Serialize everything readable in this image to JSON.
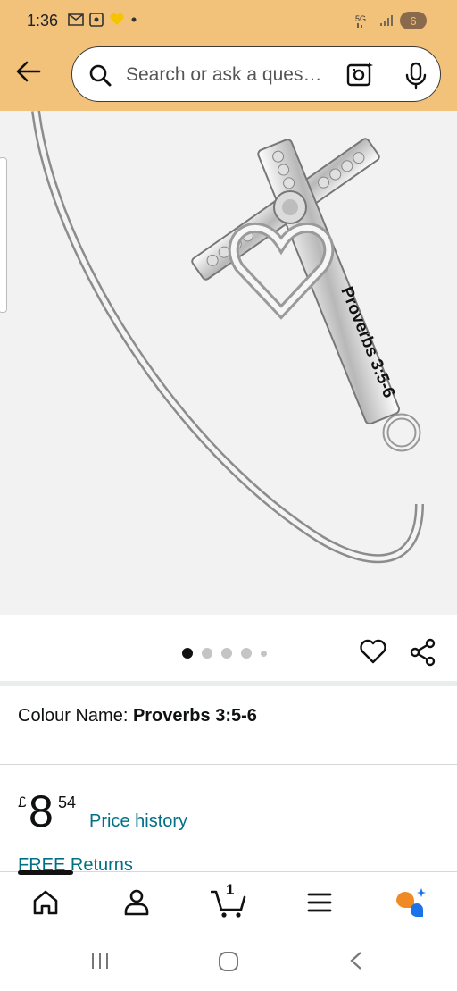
{
  "status_bar": {
    "time": "1:36",
    "battery": "6",
    "network": "5G"
  },
  "search": {
    "placeholder": "Search or ask a question"
  },
  "product_image": {
    "engraving": "Proverbs 3:5-6"
  },
  "carousel": {
    "dot_count": 5,
    "active_index": 0
  },
  "variant": {
    "label": "Colour Name: ",
    "value": "Proverbs 3:5-6"
  },
  "price": {
    "currency": "£",
    "whole": "8",
    "fraction": "54",
    "history_link": "Price history"
  },
  "returns": {
    "label": "FREE Returns"
  },
  "bottom_nav": {
    "cart_count": "1",
    "items": [
      "home-icon",
      "account-icon",
      "cart-icon",
      "menu-icon",
      "ai-assistant-icon"
    ]
  },
  "colors": {
    "header": "#f2c17a",
    "link": "#007185",
    "ai_orange": "#f08a24",
    "ai_blue": "#1a73e8"
  }
}
